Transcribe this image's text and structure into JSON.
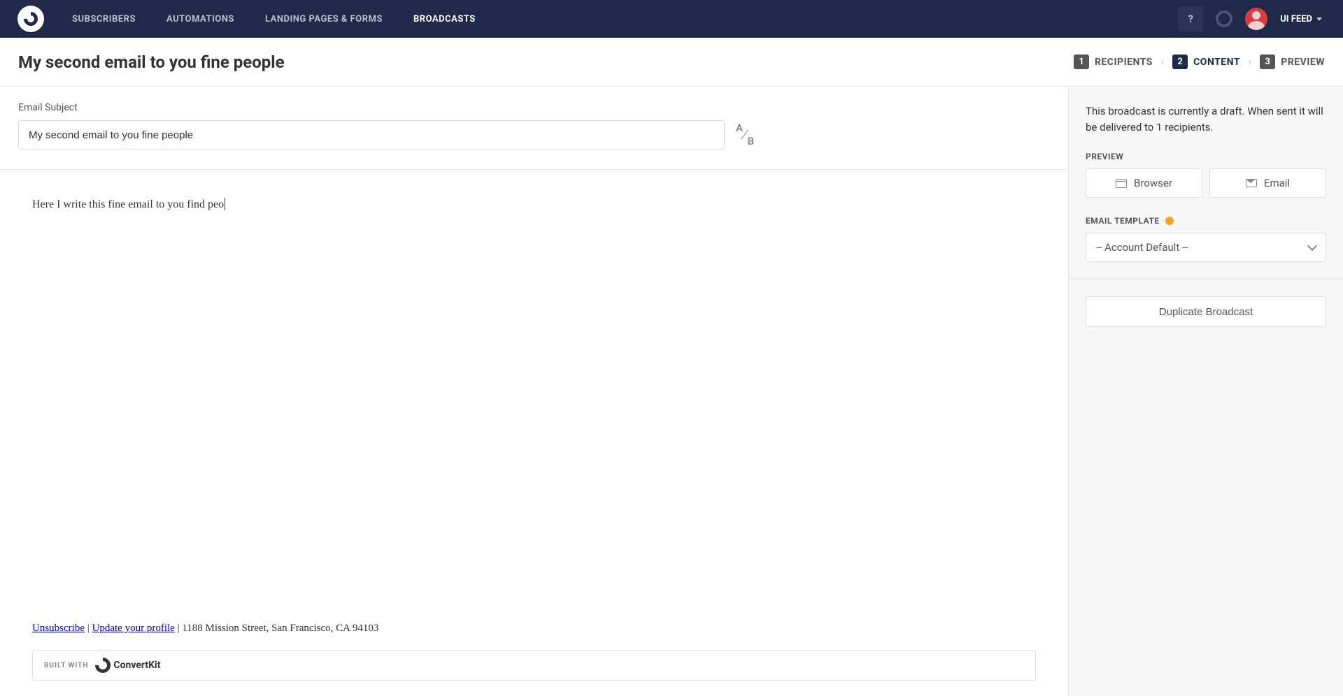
{
  "nav": {
    "items": [
      "SUBSCRIBERS",
      "AUTOMATIONS",
      "LANDING PAGES & FORMS",
      "BROADCASTS"
    ],
    "help": "?",
    "user": "UI FEED"
  },
  "page_title": "My second email to you fine people",
  "steps": [
    {
      "num": "1",
      "label": "RECIPIENTS"
    },
    {
      "num": "2",
      "label": "CONTENT"
    },
    {
      "num": "3",
      "label": "PREVIEW"
    }
  ],
  "subject": {
    "label": "Email Subject",
    "value": "My second email to you fine people",
    "ab_a": "A",
    "ab_b": "B",
    "ab_slash": "/"
  },
  "body": {
    "text": "Here I write this fine email to you find peo"
  },
  "footer": {
    "unsubscribe": "Unsubscribe",
    "sep1": " | ",
    "update": "Update your profile",
    "sep2": " | ",
    "address": "1188 Mission Street, San Francisco, CA 94103",
    "built_with": "BUILT WITH",
    "brand": "ConvertKit"
  },
  "sidebar": {
    "draft_note": "This broadcast is currently a draft. When sent it will be delivered to 1 recipients.",
    "preview_label": "PREVIEW",
    "browser": "Browser",
    "email": "Email",
    "template_label": "EMAIL TEMPLATE",
    "template_value": "-- Account Default --",
    "duplicate": "Duplicate Broadcast"
  }
}
